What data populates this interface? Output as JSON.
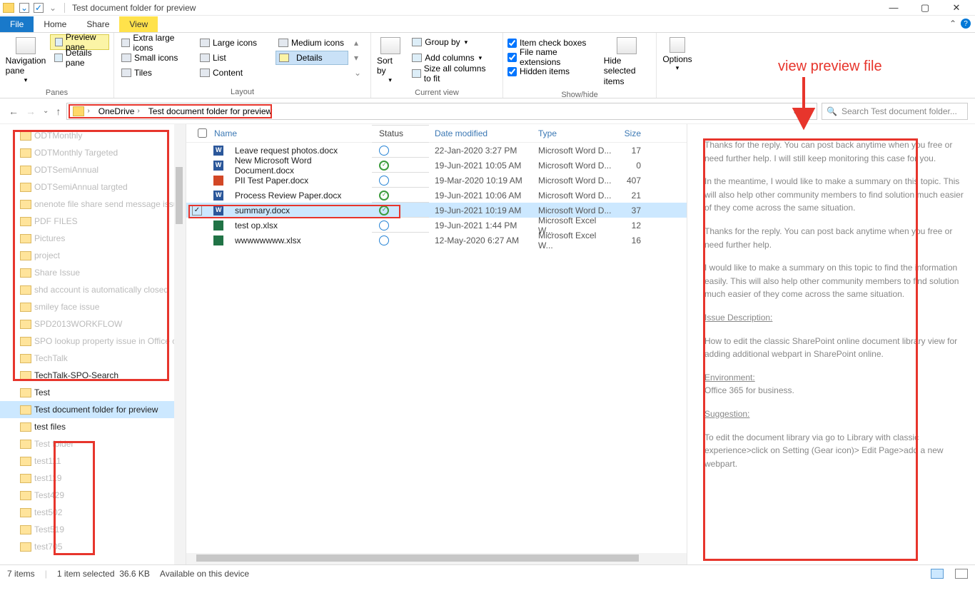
{
  "window": {
    "title": "Test document folder for preview"
  },
  "tabs": {
    "file": "File",
    "home": "Home",
    "share": "Share",
    "view": "View"
  },
  "ribbon": {
    "panes": {
      "label": "Panes",
      "navigation": "Navigation pane",
      "preview": "Preview pane",
      "details": "Details pane"
    },
    "layout": {
      "label": "Layout",
      "items": [
        "Extra large icons",
        "Large icons",
        "Medium icons",
        "Small icons",
        "List",
        "Details",
        "Tiles",
        "Content"
      ]
    },
    "currentview": {
      "label": "Current view",
      "sort": "Sort by",
      "group": "Group by",
      "addcols": "Add columns",
      "sizeall": "Size all columns to fit"
    },
    "showhide": {
      "label": "Show/hide",
      "itemcheck": "Item check boxes",
      "fileext": "File name extensions",
      "hidden": "Hidden items",
      "hidesel": "Hide selected items"
    },
    "options": "Options"
  },
  "breadcrumbs": {
    "seg1": "OneDrive",
    "seg2": "Test document folder for preview"
  },
  "search": {
    "placeholder": "Search Test document folder..."
  },
  "tree": {
    "items": [
      "ODTMonthly",
      "ODTMonthly Targeted",
      "ODTSemiAnnual",
      "ODTSemiAnnual targted",
      "onenote file share send message issue",
      "PDF FILES",
      "Pictures",
      "project",
      "Share Issue",
      "shd account is automatically closed",
      "smiley face issue",
      "SPD2013WORKFLOW",
      "SPO lookup property issue in Office client",
      "TechTalk",
      "TechTalk-SPO-Search",
      "Test",
      "Test document folder for preview",
      "test files",
      "Test folder",
      "test111",
      "test119",
      "Test429",
      "test502",
      "Test519",
      "test705"
    ]
  },
  "columns": {
    "name": "Name",
    "status": "Status",
    "date": "Date modified",
    "type": "Type",
    "size": "Size"
  },
  "files": [
    {
      "name": "Leave request photos.docx",
      "icon": "word",
      "status": "cloud",
      "date": "22-Jan-2020 3:27 PM",
      "type": "Microsoft Word D...",
      "size": "17"
    },
    {
      "name": "New Microsoft Word Document.docx",
      "icon": "word",
      "status": "synced",
      "date": "19-Jun-2021 10:05 AM",
      "type": "Microsoft Word D...",
      "size": "0"
    },
    {
      "name": "PII Test Paper.docx",
      "icon": "ppt",
      "status": "cloud",
      "date": "19-Mar-2020 10:19 AM",
      "type": "Microsoft Word D...",
      "size": "407"
    },
    {
      "name": "Process Review Paper.docx",
      "icon": "word",
      "status": "synced",
      "date": "19-Jun-2021 10:06 AM",
      "type": "Microsoft Word D...",
      "size": "21"
    },
    {
      "name": "summary.docx",
      "icon": "word",
      "status": "synced",
      "date": "19-Jun-2021 10:19 AM",
      "type": "Microsoft Word D...",
      "size": "37"
    },
    {
      "name": "test op.xlsx",
      "icon": "xls",
      "status": "cloud",
      "date": "19-Jun-2021 1:44 PM",
      "type": "Microsoft Excel W...",
      "size": "12"
    },
    {
      "name": "wwwwwwww.xlsx",
      "icon": "xls",
      "status": "cloud",
      "date": "12-May-2020 6:27 AM",
      "type": "Microsoft Excel W...",
      "size": "16"
    }
  ],
  "annotation": {
    "label": "view preview file"
  },
  "preview": {
    "p1": "Thanks for the reply. You can post back anytime when you free or need further help. I will still keep monitoring this case for you.",
    "p2": "In the meantime, I would like to make a summary on this topic. This will also help other community members to find solution much easier of they come across the same situation.",
    "p3": "Thanks for the reply. You can post back anytime when you free or need further help.",
    "p4": "I would like to make a summary on this topic to find the information easily. This will also help other community members to find solution much easier of they come across the same situation.",
    "h1": "Issue Description:",
    "p5": "How to edit the classic SharePoint online document library view for adding additional webpart in SharePoint online.",
    "h2": "Environment:",
    "p6": "Office 365 for business.",
    "h3": "Suggestion:",
    "p7": "To edit the document library via go to Library with classic experience>click on Setting (Gear icon)> Edit Page>add a new webpart."
  },
  "status": {
    "items": "7 items",
    "selected": "1 item selected",
    "size": "36.6 KB",
    "available": "Available on this device"
  }
}
